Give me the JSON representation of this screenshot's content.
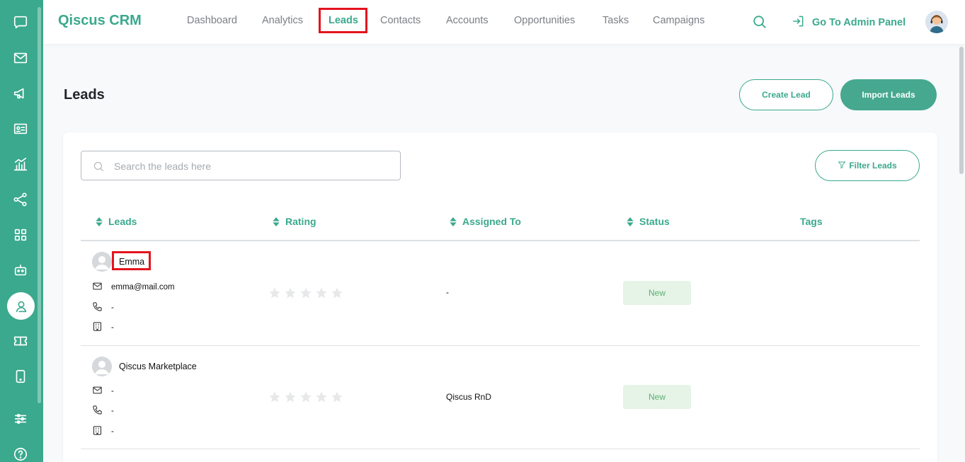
{
  "brand": "Qiscus CRM",
  "nav": {
    "items": [
      {
        "label": "Dashboard"
      },
      {
        "label": "Analytics"
      },
      {
        "label": "Leads",
        "active": true
      },
      {
        "label": "Contacts"
      },
      {
        "label": "Accounts"
      },
      {
        "label": "Opportunities"
      },
      {
        "label": "Tasks"
      },
      {
        "label": "Campaigns"
      }
    ],
    "admin_label": "Go To Admin Panel"
  },
  "sidebar": {
    "icons": [
      "chat-icon",
      "mail-icon",
      "megaphone-icon",
      "contact-card-icon",
      "analytics-icon",
      "share-icon",
      "apps-grid-icon",
      "bot-icon",
      "leads-icon",
      "ticket-icon",
      "mobile-icon",
      "settings-sliders-icon",
      "help-icon"
    ],
    "active": "leads-icon"
  },
  "page": {
    "title": "Leads",
    "create_label": "Create Lead",
    "import_label": "Import Leads"
  },
  "search": {
    "placeholder": "Search the leads here",
    "value": ""
  },
  "filter_label": "Filter Leads",
  "table": {
    "columns": [
      "Leads",
      "Rating",
      "Assigned To",
      "Status",
      "Tags"
    ],
    "rows": [
      {
        "name": "Emma",
        "email": "emma@mail.com",
        "phone": "-",
        "company": "-",
        "rating": 0,
        "assigned": "-",
        "status": "New",
        "tags": ""
      },
      {
        "name": "Qiscus Marketplace",
        "email": "-",
        "phone": "-",
        "company": "-",
        "rating": 0,
        "assigned": "Qiscus RnD",
        "status": "New",
        "tags": ""
      }
    ]
  },
  "colors": {
    "accent": "#3aa98d",
    "highlight": "#e3141e",
    "status_bg": "#e5f4e7",
    "status_text": "#5dae73"
  }
}
